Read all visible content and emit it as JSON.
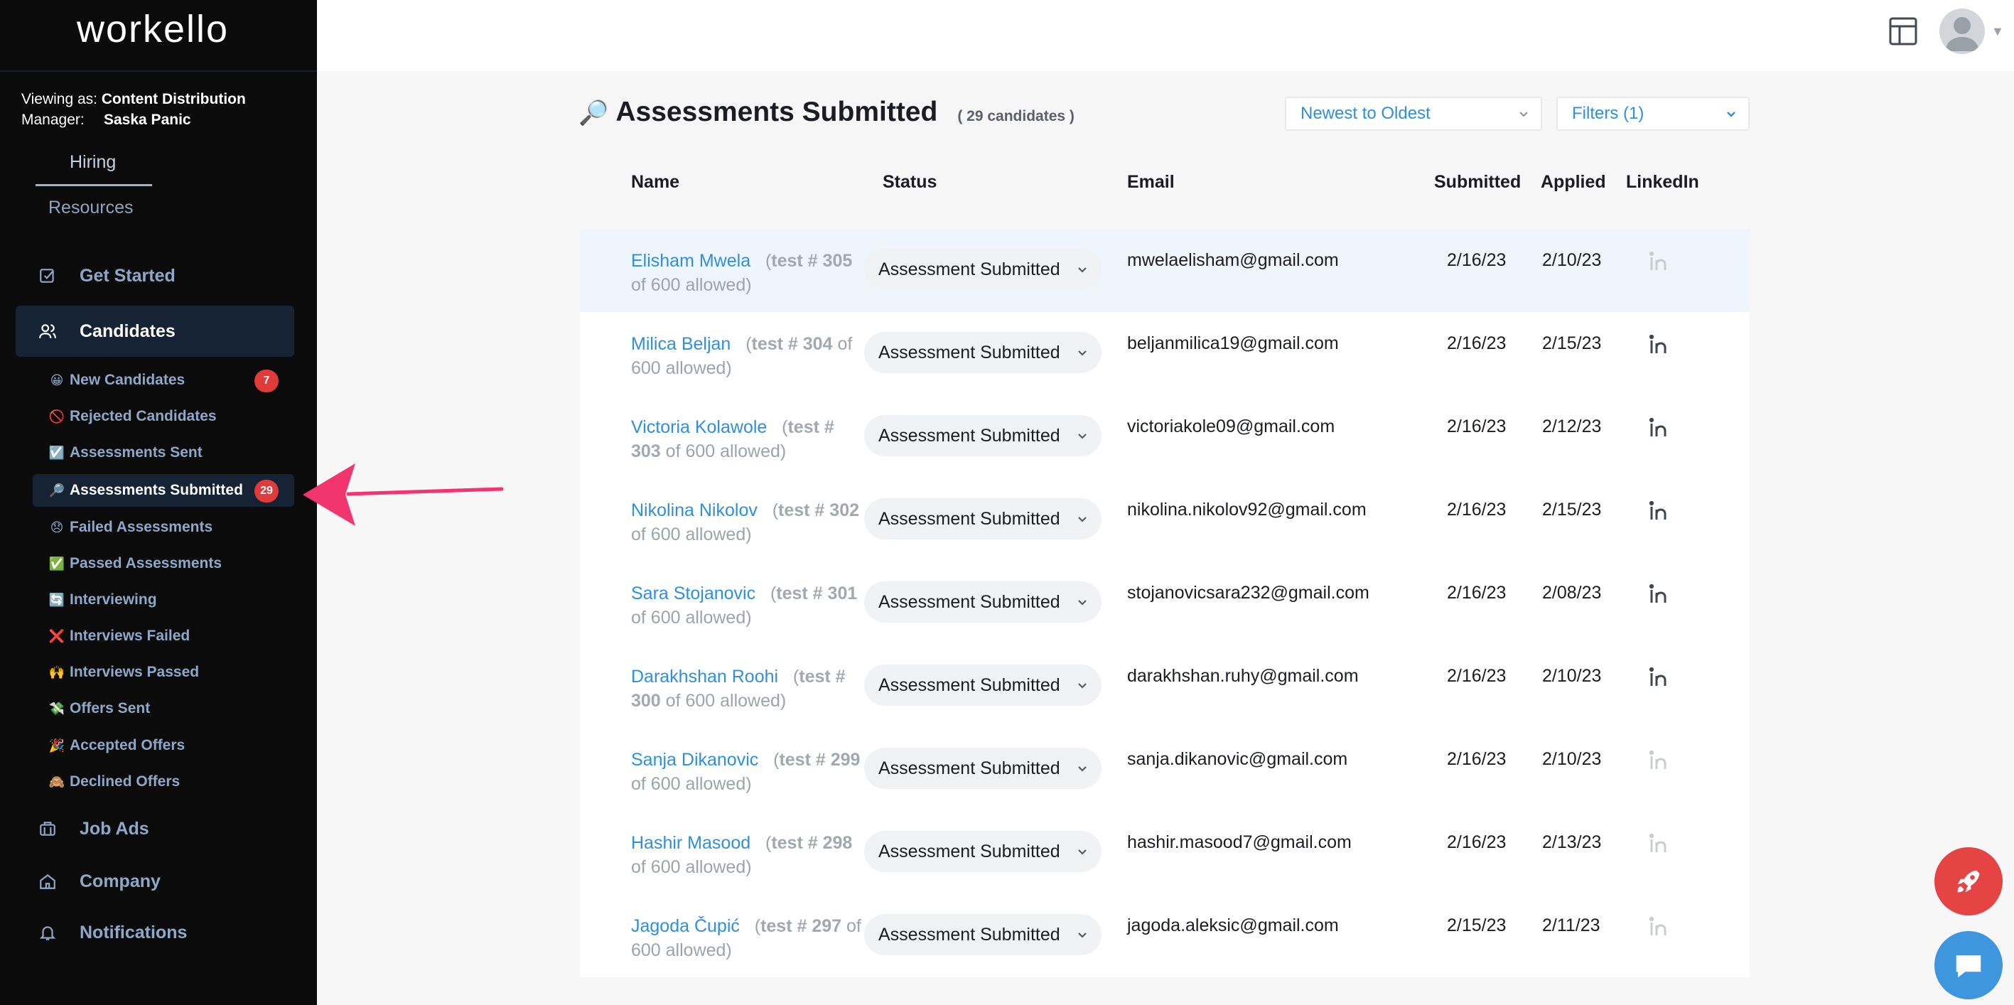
{
  "app": {
    "logo": "workello"
  },
  "viewer": {
    "viewing_as_label": "Viewing as:",
    "viewing_as_value": "Content Distribution",
    "manager_label": "Manager:",
    "manager_value": "Saska Panic"
  },
  "topnav": {
    "hiring": "Hiring",
    "resources": "Resources"
  },
  "sidebar": {
    "get_started": "Get Started",
    "candidates": "Candidates",
    "job_ads": "Job Ads",
    "company": "Company",
    "notifications": "Notifications",
    "sub_items": [
      {
        "emoji": "😀",
        "label": "New Candidates",
        "badge": "7"
      },
      {
        "emoji": "🚫",
        "label": "Rejected Candidates"
      },
      {
        "emoji": "☑️",
        "label": "Assessments Sent"
      },
      {
        "emoji": "🔎",
        "label": "Assessments Submitted",
        "badge": "29"
      },
      {
        "emoji": "😞",
        "label": "Failed Assessments"
      },
      {
        "emoji": "✅",
        "label": "Passed Assessments"
      },
      {
        "emoji": "🔄",
        "label": "Interviewing"
      },
      {
        "emoji": "❌",
        "label": "Interviews Failed"
      },
      {
        "emoji": "🙌",
        "label": "Interviews Passed"
      },
      {
        "emoji": "💸",
        "label": "Offers Sent"
      },
      {
        "emoji": "🎉",
        "label": "Accepted Offers"
      },
      {
        "emoji": "🙈",
        "label": "Declined Offers"
      }
    ]
  },
  "page": {
    "icon": "🔎",
    "title": "Assessments Submitted",
    "count": "( 29 candidates )",
    "sort_value": "Newest to Oldest",
    "filters_value": "Filters (1)"
  },
  "table": {
    "headers": {
      "name": "Name",
      "status": "Status",
      "email": "Email",
      "submitted": "Submitted",
      "applied": "Applied",
      "linkedin": "LinkedIn"
    },
    "rows": [
      {
        "name": "Elisham Mwela",
        "test": "test # 305",
        "allowed": "of 600 allowed)",
        "status": "Assessment Submitted",
        "email": "mwelaelisham@gmail.com",
        "submitted": "2/16/23",
        "applied": "2/10/23",
        "linkedin_active": false
      },
      {
        "name": "Milica Beljan",
        "test": "test # 304",
        "allowed": "of 600 allowed)",
        "status": "Assessment Submitted",
        "email": "beljanmilica19@gmail.com",
        "submitted": "2/16/23",
        "applied": "2/15/23",
        "linkedin_active": true
      },
      {
        "name": "Victoria Kolawole",
        "test": "test # 303",
        "allowed": "of 600 allowed)",
        "status": "Assessment Submitted",
        "email": "victoriakole09@gmail.com",
        "submitted": "2/16/23",
        "applied": "2/12/23",
        "linkedin_active": true
      },
      {
        "name": "Nikolina Nikolov",
        "test": "test # 302",
        "allowed": "of 600 allowed)",
        "status": "Assessment Submitted",
        "email": "nikolina.nikolov92@gmail.com",
        "submitted": "2/16/23",
        "applied": "2/15/23",
        "linkedin_active": true
      },
      {
        "name": "Sara Stojanovic",
        "test": "test # 301",
        "allowed": "of 600 allowed)",
        "status": "Assessment Submitted",
        "email": "stojanovicsara232@gmail.com",
        "submitted": "2/16/23",
        "applied": "2/08/23",
        "linkedin_active": true
      },
      {
        "name": "Darakhshan Roohi",
        "test": "test # 300",
        "allowed": "of 600 allowed)",
        "status": "Assessment Submitted",
        "email": "darakhshan.ruhy@gmail.com",
        "submitted": "2/16/23",
        "applied": "2/10/23",
        "linkedin_active": true
      },
      {
        "name": "Sanja Dikanovic",
        "test": "test # 299",
        "allowed": "of 600 allowed)",
        "status": "Assessment Submitted",
        "email": "sanja.dikanovic@gmail.com",
        "submitted": "2/16/23",
        "applied": "2/10/23",
        "linkedin_active": false
      },
      {
        "name": "Hashir Masood",
        "test": "test # 298",
        "allowed": "of 600 allowed)",
        "status": "Assessment Submitted",
        "email": "hashir.masood7@gmail.com",
        "submitted": "2/16/23",
        "applied": "2/13/23",
        "linkedin_active": false
      },
      {
        "name": "Jagoda Čupić",
        "test": "test # 297",
        "allowed": "of 600 allowed)",
        "status": "Assessment Submitted",
        "email": "jagoda.aleksic@gmail.com",
        "submitted": "2/15/23",
        "applied": "2/11/23",
        "linkedin_active": false
      }
    ]
  },
  "colors": {
    "accent": "#2f8fdd",
    "sidebar_bg": "#0b0b0c",
    "badge": "#e03b3b",
    "arrow": "#f2356f"
  },
  "icons": {
    "get_started": "checkbox-icon",
    "candidates": "users-icon",
    "job_ads": "briefcase-icon",
    "company": "home-icon",
    "notifications": "bell-icon",
    "layout": "layout-icon",
    "rocket": "rocket-icon",
    "chat": "chat-icon"
  }
}
